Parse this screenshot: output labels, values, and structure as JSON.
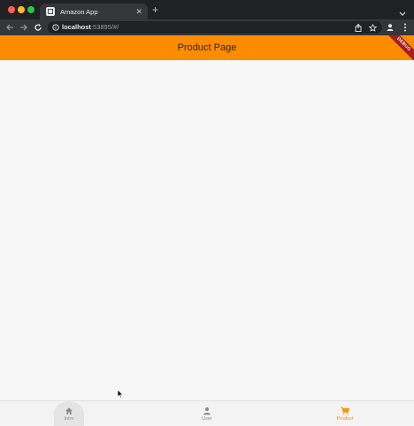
{
  "browser": {
    "tab_title": "Amazon App",
    "tab_close": "✕",
    "new_tab": "+",
    "url_host": "localhost",
    "url_rest": ":53895/#/"
  },
  "app": {
    "title": "Product Page",
    "debug_banner": "DEBUG",
    "accent_color": "#fb8c00"
  },
  "bottom_nav": {
    "items": [
      {
        "label": "Intro",
        "icon": "home-icon"
      },
      {
        "label": "User",
        "icon": "person-icon"
      },
      {
        "label": "Product",
        "icon": "cart-icon"
      }
    ],
    "selected": "Product"
  }
}
